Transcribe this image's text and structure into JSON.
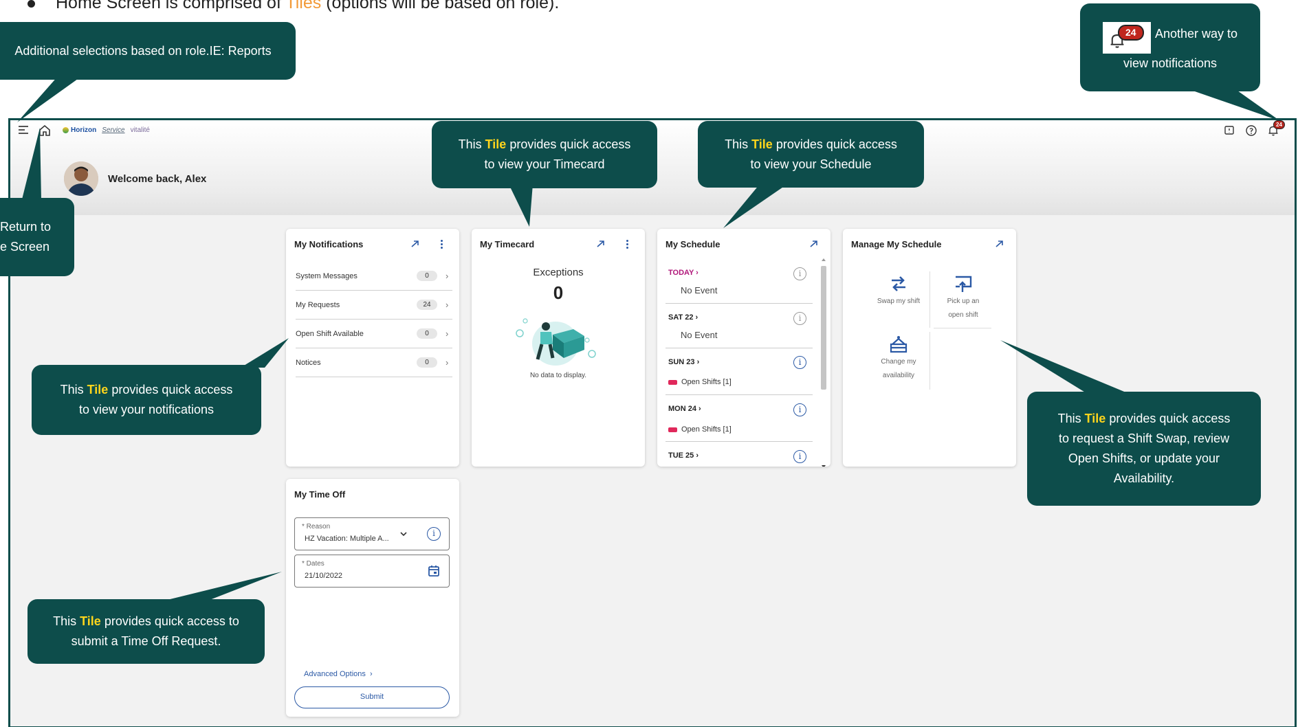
{
  "slide": {
    "bullet_prefix": "Home Screen is comprised of ",
    "bullet_highlight": "Tiles",
    "bullet_suffix": " (options will be based on role)."
  },
  "app": {
    "logos": {
      "horizon": "Horizon",
      "service": "Service",
      "vitalite": "vitalité"
    },
    "notification_badge": "24",
    "welcome": "Welcome back, Alex"
  },
  "tiles": {
    "notifications": {
      "title": "My Notifications",
      "rows": [
        {
          "label": "System Messages",
          "count": "0"
        },
        {
          "label": "My Requests",
          "count": "24"
        },
        {
          "label": "Open Shift Available",
          "count": "0"
        },
        {
          "label": "Notices",
          "count": "0"
        }
      ]
    },
    "timecard": {
      "title": "My Timecard",
      "exceptions_label": "Exceptions",
      "exceptions_count": "0",
      "no_data": "No data to display."
    },
    "schedule": {
      "title": "My Schedule",
      "today": "TODAY",
      "no_event": "No Event",
      "days": [
        "SAT 22",
        "SUN 23",
        "MON 24",
        "TUE 25"
      ],
      "open_shifts": "Open Shifts [1]"
    },
    "manage": {
      "title": "Manage My Schedule",
      "swap": "Swap my shift",
      "pickup_line1": "Pick up an",
      "pickup_line2": "open shift",
      "change_line1": "Change my",
      "change_line2": "availability"
    },
    "timeoff": {
      "title": "My Time Off",
      "reason_label": "* Reason",
      "reason_value": "HZ Vacation: Multiple A...",
      "dates_label": "* Dates",
      "dates_value": "21/10/2022",
      "advanced": "Advanced Options",
      "submit": "Submit"
    }
  },
  "callouts": {
    "reports": "Additional selections based on role.IE: Reports",
    "return_line1": "Return to",
    "return_line2": "e Screen",
    "bell_badge": "24",
    "bell_text_line1": "Another way to",
    "bell_text_line2": "view notifications",
    "tile_word": "Tile",
    "this_word": "This",
    "timecard_a": "provides quick access",
    "timecard_b": "to view your Timecard",
    "schedule_a": "provides quick access",
    "schedule_b": "to view your Schedule",
    "notifications_a": "provides quick access",
    "notifications_b": "to view your notifications",
    "manage_a": "provides quick access",
    "manage_b": "to request a Shift Swap, review",
    "manage_c": "Open Shifts, or update your",
    "manage_d": "Availability.",
    "timeoff_a": "provides quick access to",
    "timeoff_b": "submit a Time Off Request."
  },
  "colors": {
    "callout": "#0d4d4b",
    "highlight": "#ffd51c",
    "accent": "#2b59a5",
    "today": "#b0177a",
    "open_shift": "#e0285b"
  }
}
